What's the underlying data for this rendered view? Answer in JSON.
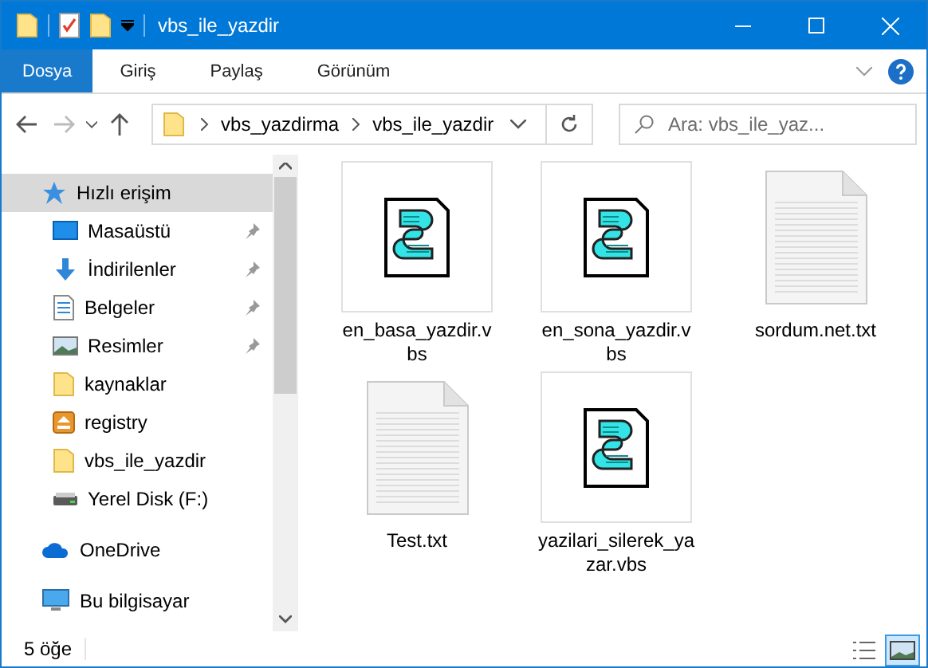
{
  "window": {
    "title": "vbs_ile_yazdir"
  },
  "ribbon_tabs": [
    {
      "label": "Dosya",
      "selected": true
    },
    {
      "label": "Giriş",
      "selected": false
    },
    {
      "label": "Paylaş",
      "selected": false
    },
    {
      "label": "Görünüm",
      "selected": false
    }
  ],
  "breadcrumb": [
    "vbs_yazdirma",
    "vbs_ile_yazdir"
  ],
  "search": {
    "placeholder": "Ara: vbs_ile_yaz..."
  },
  "sidebar": {
    "items": [
      {
        "label": "Hızlı erişim",
        "kind": "star",
        "selected": true,
        "pinned": false
      },
      {
        "label": "Masaüstü",
        "kind": "desktop",
        "selected": false,
        "pinned": true
      },
      {
        "label": "İndirilenler",
        "kind": "download",
        "selected": false,
        "pinned": true
      },
      {
        "label": "Belgeler",
        "kind": "document",
        "selected": false,
        "pinned": true
      },
      {
        "label": "Resimler",
        "kind": "pictures",
        "selected": false,
        "pinned": true
      },
      {
        "label": "kaynaklar",
        "kind": "folder",
        "selected": false,
        "pinned": false
      },
      {
        "label": "registry",
        "kind": "registry",
        "selected": false,
        "pinned": false
      },
      {
        "label": "vbs_ile_yazdir",
        "kind": "folder",
        "selected": false,
        "pinned": false
      },
      {
        "label": "Yerel Disk (F:)",
        "kind": "drive",
        "selected": false,
        "pinned": false
      },
      {
        "label": "OneDrive",
        "kind": "onedrive",
        "selected": false,
        "pinned": false
      },
      {
        "label": "Bu bilgisayar",
        "kind": "pc",
        "selected": false,
        "pinned": false
      }
    ]
  },
  "files": [
    {
      "name_lines": [
        "en_basa_yazdir.v",
        "bs"
      ],
      "kind": "vbs"
    },
    {
      "name_lines": [
        "en_sona_yazdir.v",
        "bs"
      ],
      "kind": "vbs"
    },
    {
      "name_lines": [
        "sordum.net.txt"
      ],
      "kind": "txt"
    },
    {
      "name_lines": [
        "Test.txt"
      ],
      "kind": "txt"
    },
    {
      "name_lines": [
        "yazilari_silerek_ya",
        "zar.vbs"
      ],
      "kind": "vbs"
    }
  ],
  "status_bar": {
    "count": "5 öğe"
  },
  "view_buttons": [
    {
      "kind": "details",
      "selected": false
    },
    {
      "kind": "large_icons",
      "selected": true
    }
  ]
}
